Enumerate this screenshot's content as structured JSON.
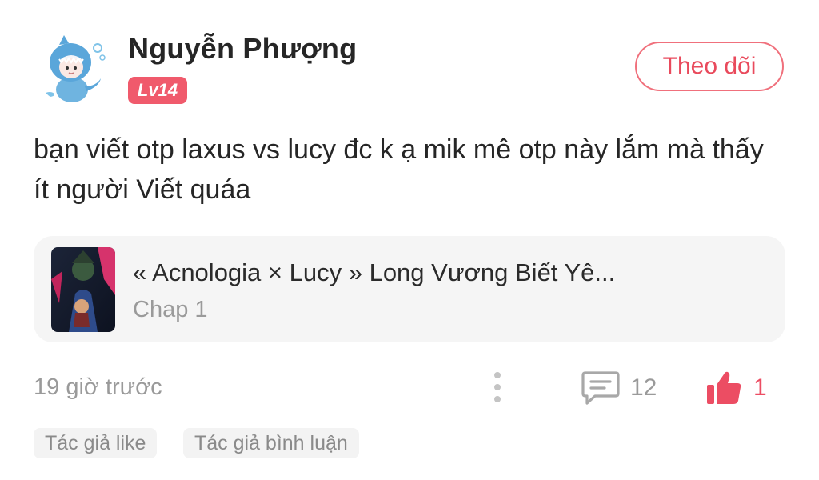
{
  "author": {
    "name": "Nguyễn Phượng",
    "level": "Lv14",
    "avatar_icon": "shark-hoodie-avatar"
  },
  "follow_label": "Theo dõi",
  "comment": {
    "text": "bạn viết otp laxus vs lucy đc k ạ mik mê otp này lắm mà thấy ít người Viết quáa"
  },
  "story": {
    "title": "« Acnologia × Lucy » Long Vương Biết Yê...",
    "chapter": "Chap 1"
  },
  "meta": {
    "timestamp": "19 giờ trước",
    "reply_count": "12",
    "like_count": "1"
  },
  "tags": [
    "Tác giả like",
    "Tác giả bình luận"
  ],
  "colors": {
    "accent": "#ec4d63",
    "badge": "#f05a6c",
    "muted": "#9a9a9a",
    "card_bg": "#f5f5f5"
  },
  "icons": {
    "more": "more-vertical-icon",
    "reply": "comment-icon",
    "like": "thumbs-up-icon"
  }
}
